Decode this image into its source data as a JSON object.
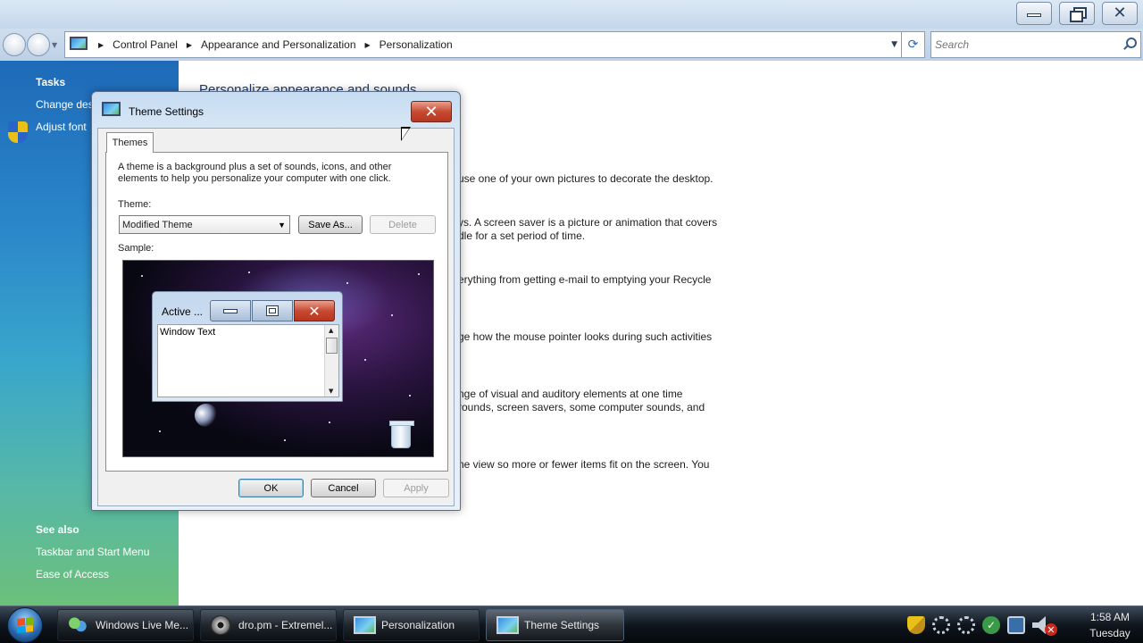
{
  "window": {
    "caption_buttons": [
      "minimize",
      "maximize",
      "close"
    ]
  },
  "address_bar": {
    "breadcrumbs": [
      "Control Panel",
      "Appearance and Personalization",
      "Personalization"
    ],
    "icon": "control-panel-icon"
  },
  "search": {
    "placeholder": "Search",
    "icon": "search-icon"
  },
  "task_pane": {
    "tasks_heading": "Tasks",
    "tasks": [
      "Change des",
      "Adjust font"
    ],
    "see_also_heading": "See also",
    "see_also": [
      "Taskbar and Start Menu",
      "Ease of Access"
    ]
  },
  "main": {
    "title": "Personalize appearance and sounds",
    "descriptions": [
      [
        "use one of your own pictures to decorate the desktop."
      ],
      [
        "ys. A screen saver is a picture or animation that covers",
        "dle for a set period of time."
      ],
      [
        "erything from getting e-mail to emptying your Recycle"
      ],
      [
        "ge how the mouse pointer looks during such activities"
      ],
      [
        "nge of visual and auditory elements at one time",
        "rounds, screen savers, some computer sounds, and"
      ],
      [
        "ne view so more or fewer items fit on the screen. You"
      ]
    ]
  },
  "dialog": {
    "title": "Theme Settings",
    "tab": "Themes",
    "description": "A theme is a background plus a set of sounds, icons, and other elements to help you personalize your computer with one click.",
    "theme_label": "Theme:",
    "theme_value": "Modified Theme",
    "save_as": "Save As...",
    "delete": "Delete",
    "sample_label": "Sample:",
    "preview": {
      "window_title": "Active ...",
      "window_text": "Window Text"
    },
    "ok": "OK",
    "cancel": "Cancel",
    "apply": "Apply"
  },
  "taskbar": {
    "buttons": [
      {
        "label": "Windows Live Me...",
        "icon": "messenger-icon"
      },
      {
        "label": "dro.pm - Extremel...",
        "icon": "media-icon"
      },
      {
        "label": "Personalization",
        "icon": "control-panel-icon"
      },
      {
        "label": "Theme Settings",
        "icon": "control-panel-icon"
      }
    ],
    "time": "1:58 AM",
    "day": "Tuesday"
  },
  "colors": {
    "task_pane_top": "#1e6ab8",
    "task_pane_bottom": "#6cc07a",
    "close_red": "#c74a32",
    "link_text": "#ffffff"
  }
}
